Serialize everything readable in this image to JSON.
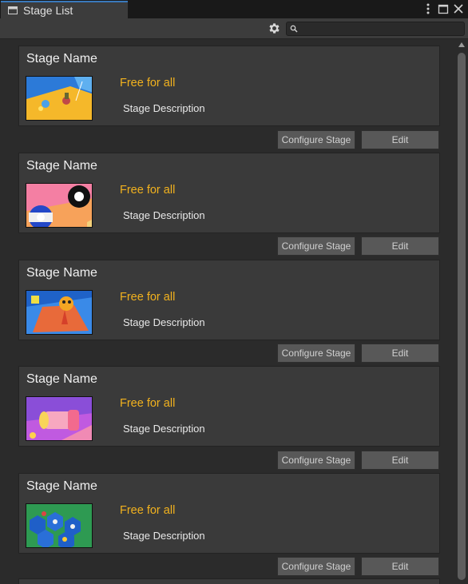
{
  "window": {
    "title": "Stage List",
    "controls": [
      "kebab-menu-icon",
      "maximize-icon",
      "close-icon"
    ]
  },
  "toolbar": {
    "search_value": "",
    "icons": [
      "gear-icon",
      "search-icon"
    ]
  },
  "stages": [
    {
      "name": "Stage Name",
      "price": "Free for all",
      "description": "Stage Description",
      "configure_label": "Configure Stage",
      "edit_label": "Edit",
      "thumbnail": "yellow-arena-thumbnail"
    },
    {
      "name": "Stage Name",
      "price": "Free for all",
      "description": "Stage Description",
      "configure_label": "Configure Stage",
      "edit_label": "Edit",
      "thumbnail": "billiard-balls-thumbnail"
    },
    {
      "name": "Stage Name",
      "price": "Free for all",
      "description": "Stage Description",
      "configure_label": "Configure Stage",
      "edit_label": "Edit",
      "thumbnail": "orange-character-thumbnail"
    },
    {
      "name": "Stage Name",
      "price": "Free for all",
      "description": "Stage Description",
      "configure_label": "Configure Stage",
      "edit_label": "Edit",
      "thumbnail": "pink-hammer-thumbnail"
    },
    {
      "name": "Stage Name",
      "price": "Free for all",
      "description": "Stage Description",
      "configure_label": "Configure Stage",
      "edit_label": "Edit",
      "thumbnail": "blue-hex-tiles-thumbnail"
    }
  ],
  "colors": {
    "price": "#f2b21e",
    "panel_bg": "#2b2b2b",
    "card_bg": "#3a3a3a",
    "button_bg": "#585858",
    "tab_accent": "#3a79bb"
  }
}
